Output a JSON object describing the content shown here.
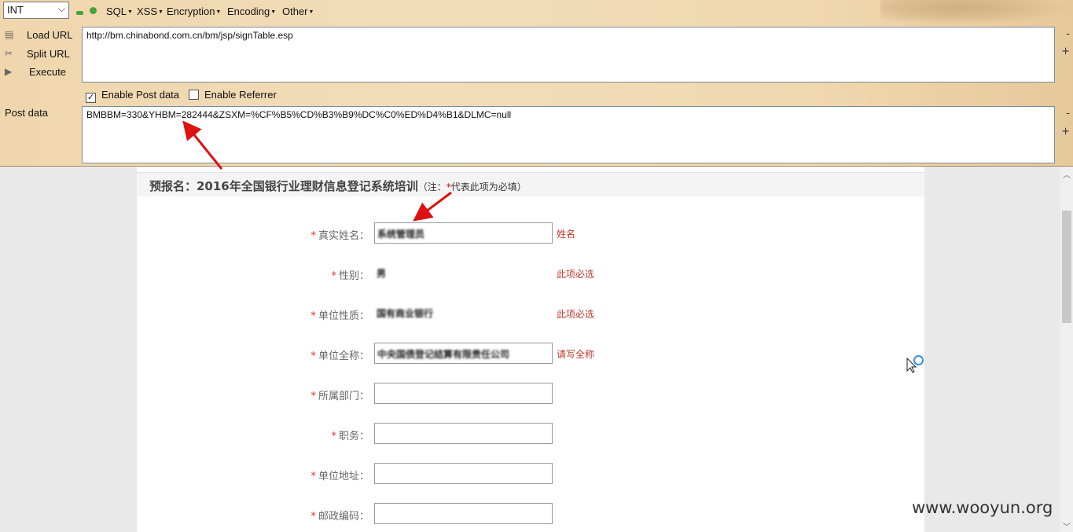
{
  "hackbar": {
    "select_value": "INT",
    "menu": [
      "SQL",
      "XSS",
      "Encryption",
      "Encoding",
      "Other"
    ],
    "buttons": {
      "load_url": "Load URL",
      "split_url": "Split URL",
      "execute": "Execute"
    },
    "url_value": "http://bm.chinabond.com.cn/bm/jsp/signTable.esp",
    "enable_post_label": "Enable Post data",
    "enable_post_checked": true,
    "enable_referrer_label": "Enable Referrer",
    "enable_referrer_checked": false,
    "post_label": "Post data",
    "post_value": "BMBBM=330&YHBM=282444&ZSXM=%CF%B5%CD%B3%B9%DC%C0%ED%D4%B1&DLMC=null",
    "minus": "-",
    "plus": "+"
  },
  "page": {
    "heading": "预报名：2016年全国银行业理财信息登记系统培训",
    "note_prefix": "（注：",
    "note_star": "*",
    "note_text": "代表此项为必填）",
    "fields": [
      {
        "label": "真实姓名：",
        "value": "系统管理员",
        "hint": "姓名",
        "style": "input"
      },
      {
        "label": "性别：",
        "value": "男",
        "hint": "此项必选",
        "style": "select"
      },
      {
        "label": "单位性质：",
        "value": "国有商业银行",
        "hint": "此项必选",
        "style": "select"
      },
      {
        "label": "单位全称：",
        "value": "中央国债登记结算有限责任公司",
        "hint": "请写全称",
        "style": "input"
      },
      {
        "label": "所属部门：",
        "value": "",
        "hint": "",
        "style": "input"
      },
      {
        "label": "职务：",
        "value": "",
        "hint": "",
        "style": "input"
      },
      {
        "label": "单位地址：",
        "value": "",
        "hint": "",
        "style": "input"
      },
      {
        "label": "邮政编码：",
        "value": "",
        "hint": "",
        "style": "input"
      }
    ],
    "required_star": "*"
  },
  "watermark": "www.wooyun.org"
}
